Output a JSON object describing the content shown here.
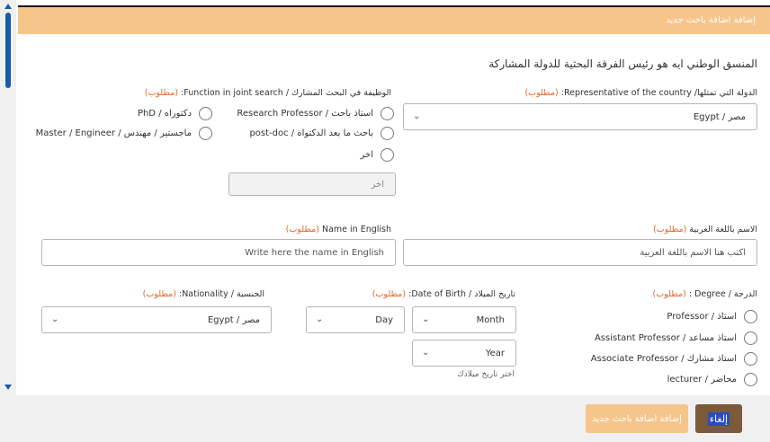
{
  "header": {
    "title": "إضافة اضافة باحث جديد"
  },
  "section": {
    "title": "المنسق الوطني ايه هو رئيس الفرقة البحثية للدولة المشاركة"
  },
  "required_tag": "(مطلوب)",
  "country": {
    "label": "الدولة التي تمثلها/ Representative of the country:",
    "value": "مصر / Egypt"
  },
  "function": {
    "label": "الوظيفة في البحث المشارك / Function in joint search:",
    "options": [
      "استاذ باحث / Research Professor",
      "دكتوراه / PhD",
      "باحث ما بعد الدكتواة / post-doc",
      "ماجستير / مهندس / Master / Engineer",
      "اخر"
    ],
    "other_placeholder": "اخر"
  },
  "name_ar": {
    "label": "الاسم باللغة العربية",
    "placeholder": "اكتب هنا الاسم باللغة العربية"
  },
  "name_en": {
    "label": "Name in English",
    "placeholder": "Write here the name in English"
  },
  "degree": {
    "label": "الدرجة / Degree :",
    "options": [
      "استاذ / Professor",
      "استاذ مساعد / Assistant Professor",
      "استاذ مشارك / Associate Professor",
      "محاضر / lecturer"
    ]
  },
  "dob": {
    "label": "تاريخ الميلاد / Date of Birth:",
    "day": "Day",
    "month": "Month",
    "year": "Year",
    "helper": "اختر تاريخ ميلادك"
  },
  "nationality": {
    "label": "الجنسية / Nationality:",
    "value": "مصر / Egypt"
  },
  "footer": {
    "cancel_label": "إلغاء",
    "add_label": "إضافة اضافة باحث جديد"
  }
}
